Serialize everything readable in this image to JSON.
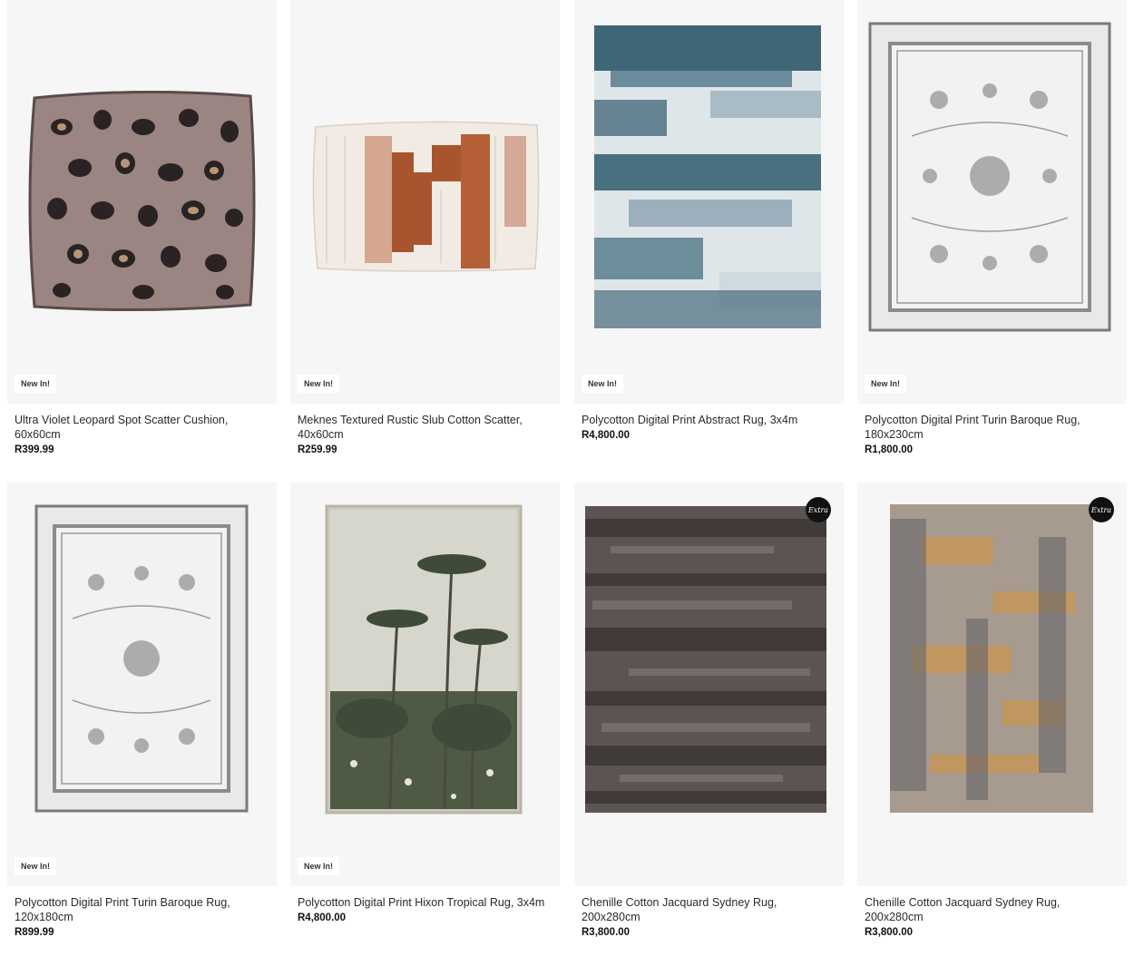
{
  "products": [
    {
      "title": "Ultra Violet Leopard Spot Scatter Cushion, 60x60cm",
      "price": "R399.99",
      "badge": "New In!",
      "image": "leopard-cushion"
    },
    {
      "title": "Meknes Textured Rustic Slub Cotton Scatter, 40x60cm",
      "price": "R259.99",
      "badge": "New In!",
      "image": "rustic-scatter"
    },
    {
      "title": "Polycotton Digital Print Abstract Rug, 3x4m",
      "price": "R4,800.00",
      "badge": "New In!",
      "image": "abstract-rug"
    },
    {
      "title": "Polycotton Digital Print Turin Baroque Rug, 180x230cm",
      "price": "R1,800.00",
      "badge": "New In!",
      "image": "baroque-rug"
    },
    {
      "title": "Polycotton Digital Print Turin Baroque Rug, 120x180cm",
      "price": "R899.99",
      "badge": "New In!",
      "image": "baroque-rug-small"
    },
    {
      "title": "Polycotton Digital Print Hixon Tropical Rug, 3x4m",
      "price": "R4,800.00",
      "badge": "New In!",
      "image": "tropical-rug"
    },
    {
      "title": "Chenille Cotton Jacquard Sydney Rug, 200x280cm",
      "price": "R3,800.00",
      "badge_extra": "Extra",
      "image": "sydney-rug-dark"
    },
    {
      "title": "Chenille Cotton Jacquard Sydney Rug, 200x280cm",
      "price": "R3,800.00",
      "badge_extra": "Extra",
      "image": "sydney-rug-gold"
    }
  ]
}
